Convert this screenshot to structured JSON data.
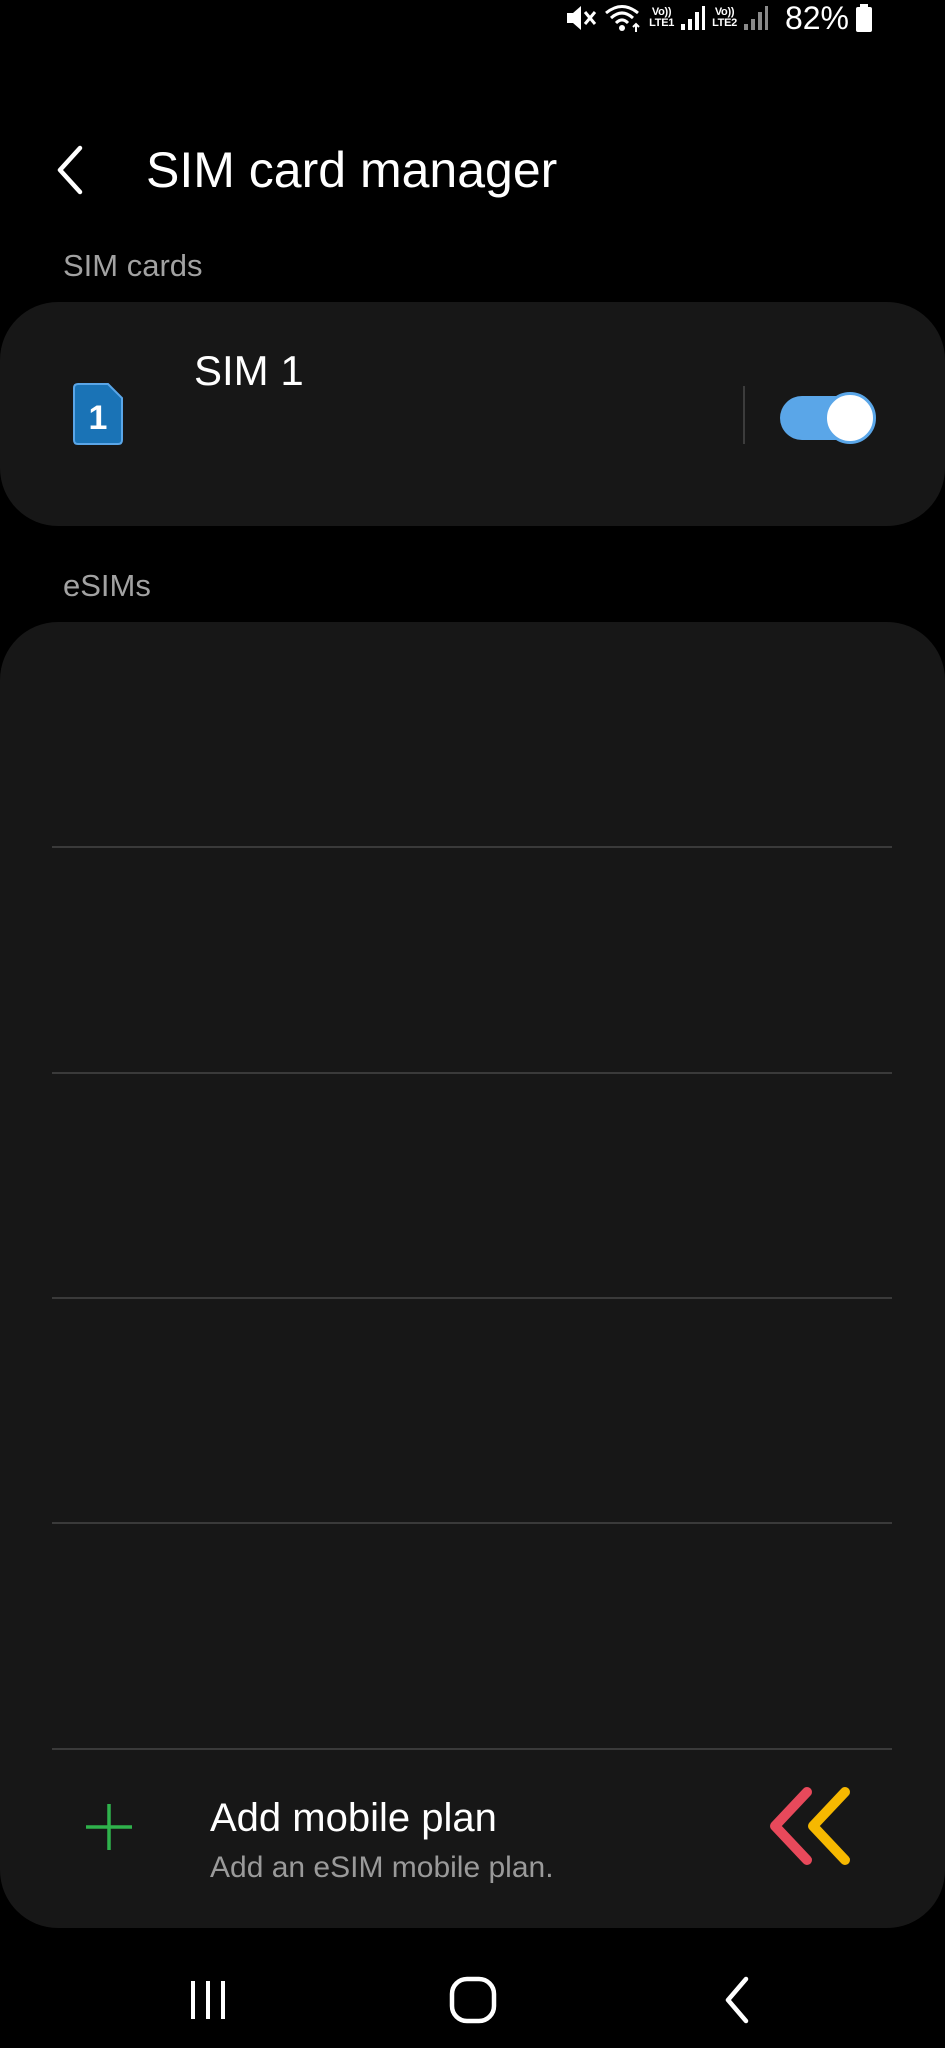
{
  "status_bar": {
    "battery": "82%",
    "sim1_label_top": "Vo))",
    "sim1_label_bottom": "LTE1",
    "sim2_label_top": "Vo))",
    "sim2_label_bottom": "LTE2",
    "icons": [
      "mute-icon",
      "wifi-icon",
      "signal-icon",
      "battery-icon"
    ]
  },
  "header": {
    "title": "SIM card manager",
    "back_icon": "back-arrow-icon"
  },
  "sections": {
    "sim_cards_label": "SIM cards",
    "esims_label": "eSIMs"
  },
  "sim_card": {
    "name": "SIM 1",
    "slot_number": "1",
    "enabled": true
  },
  "add_plan": {
    "title": "Add mobile plan",
    "subtitle": "Add an eSIM mobile plan."
  },
  "nav": {
    "icons": [
      "recent-apps-icon",
      "home-icon",
      "back-icon"
    ]
  },
  "colors": {
    "background": "#000000",
    "card": "#171717",
    "toggle_on": "#5aa6e8",
    "add_icon": "#2fb24c",
    "sim_icon": "#1a73b6",
    "logo_red": "#e8495b",
    "logo_yellow": "#f6b800"
  }
}
